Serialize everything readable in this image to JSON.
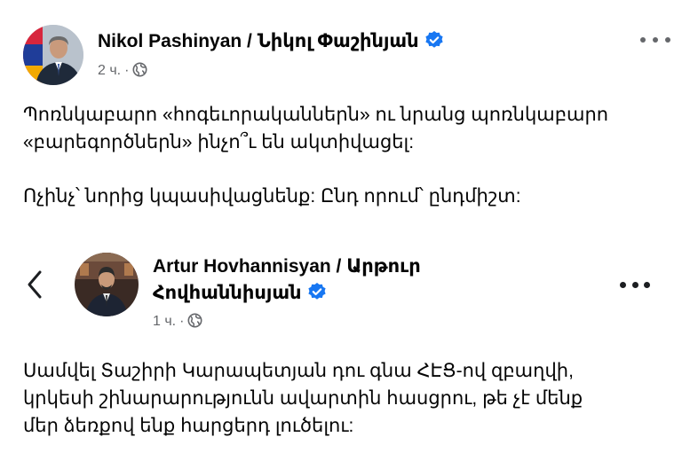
{
  "post": {
    "author": "Nikol Pashinyan / Նիկոլ Փաշինյան",
    "timestamp": "2 ч.",
    "dot": "·",
    "text_lines": [
      "Պոռնկաբարո «հոգեւորականներն» ու նրանց պոռնկաբարո",
      "«բարեգործներն» ինչո՞ւ են ակտիվացել:",
      "",
      "Ոչինչ՝ նորից կպասիվացնենք: Ընդ որում՝ ընդմիշտ:"
    ],
    "icons": {
      "verified": "verified-badge-icon",
      "audience": "globe-icon",
      "more": "more-options-icon"
    }
  },
  "shared_post": {
    "author_line1": "Artur Hovhannisyan / Արթուր",
    "author_line2": "Հովհաննիսյան",
    "timestamp": "1 ч.",
    "dot": "·",
    "text_lines": [
      "Սամվել Տաշիրի Կարապետյան դու գնա ՀԷՑ-ով զբաղվի,",
      "կրկեսի շինարարությունն ավարտին հասցրու, թե չէ մենք",
      "մեր ձեռքով ենք հարցերդ լուծելու:"
    ],
    "icons": {
      "back": "chevron-left-icon",
      "verified": "verified-badge-icon",
      "audience": "globe-icon",
      "more": "more-options-icon"
    }
  },
  "colors": {
    "verified_blue": "#1877f2",
    "secondary_text": "#65676b",
    "primary_text": "#050505"
  }
}
